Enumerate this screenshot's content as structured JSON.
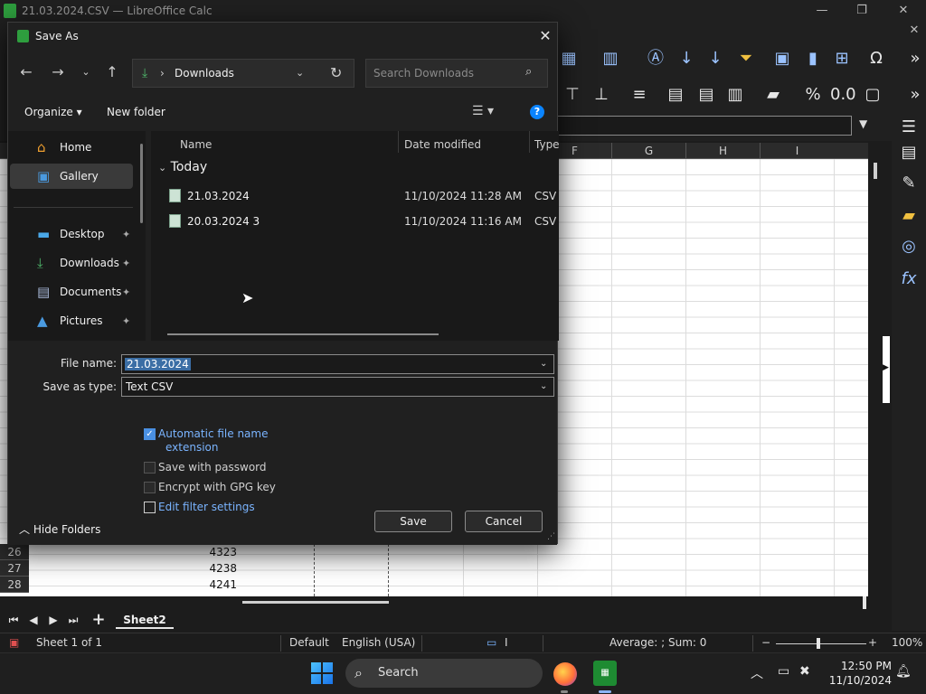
{
  "calc": {
    "window_title": "21.03.2024.CSV — LibreOffice Calc",
    "columns": [
      "F",
      "G",
      "H",
      "I"
    ],
    "rows": [
      {
        "num": "26",
        "value": "4323"
      },
      {
        "num": "27",
        "value": "4238"
      },
      {
        "num": "28",
        "value": "4241"
      }
    ],
    "sheet_tab": "Sheet2",
    "status": {
      "sheet": "Sheet 1 of 1",
      "style": "Default",
      "language": "English (USA)",
      "sum": "Average: ; Sum: 0",
      "zoom": "100%"
    }
  },
  "dialog": {
    "title": "Save As",
    "location": "Downloads",
    "search_placeholder": "Search Downloads",
    "organize": "Organize",
    "new_folder": "New folder",
    "nav": {
      "home": "Home",
      "gallery": "Gallery",
      "desktop": "Desktop",
      "downloads": "Downloads",
      "documents": "Documents",
      "pictures": "Pictures"
    },
    "headers": {
      "name": "Name",
      "date": "Date modified",
      "type": "Type"
    },
    "group": "Today",
    "files": [
      {
        "name": "21.03.2024",
        "date": "11/10/2024 11:28 AM",
        "type": "CSV File"
      },
      {
        "name": "20.03.2024 3",
        "date": "11/10/2024 11:16 AM",
        "type": "CSV File"
      }
    ],
    "file_name_label": "File name:",
    "file_name_value": "21.03.2024",
    "save_type_label": "Save as type:",
    "save_type_value": "Text CSV",
    "options": {
      "auto_ext_line1": "Automatic file name",
      "auto_ext_line2": "extension",
      "password": "Save with password",
      "gpg": "Encrypt with GPG key",
      "filter": "Edit filter settings"
    },
    "hide_folders": "Hide Folders",
    "save": "Save",
    "cancel": "Cancel"
  },
  "taskbar": {
    "search": "Search",
    "time": "12:50 PM",
    "date": "11/10/2024"
  }
}
